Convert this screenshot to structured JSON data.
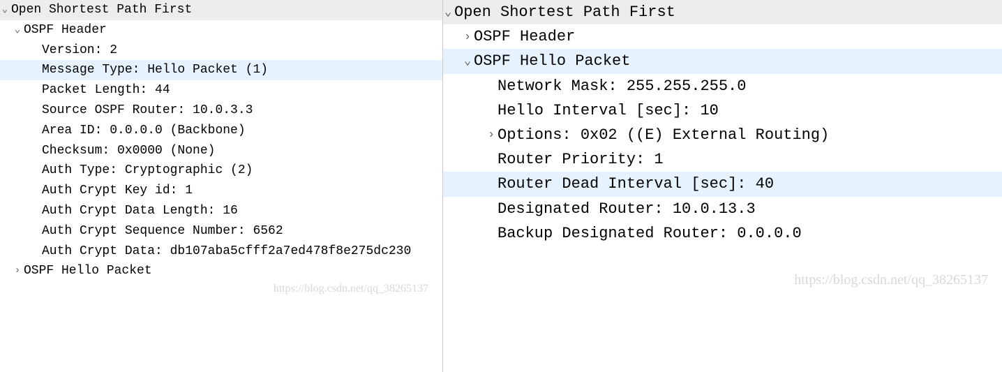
{
  "left": {
    "root": "Open Shortest Path First",
    "header_label": "OSPF Header",
    "fields": {
      "version": "Version: 2",
      "message_type": "Message Type: Hello Packet (1)",
      "packet_length": "Packet Length: 44",
      "source_router": "Source OSPF Router: 10.0.3.3",
      "area_id": "Area ID: 0.0.0.0 (Backbone)",
      "checksum": "Checksum: 0x0000 (None)",
      "auth_type": "Auth Type: Cryptographic (2)",
      "auth_key_id": "Auth Crypt Key id: 1",
      "auth_data_length": "Auth Crypt Data Length: 16",
      "auth_seq": "Auth Crypt Sequence Number: 6562",
      "auth_data": "Auth Crypt Data: db107aba5cfff2a7ed478f8e275dc230"
    },
    "hello_label": "OSPF Hello Packet",
    "watermark": "https://blog.csdn.net/qq_38265137"
  },
  "right": {
    "root": "Open Shortest Path First",
    "header_label": "OSPF Header",
    "hello_label": "OSPF Hello Packet",
    "fields": {
      "netmask": "Network Mask: 255.255.255.0",
      "hello_interval": "Hello Interval [sec]: 10",
      "options": "Options: 0x02 ((E) External Routing)",
      "router_priority": "Router Priority: 1",
      "dead_interval": "Router Dead Interval [sec]: 40",
      "dr": "Designated Router: 10.0.13.3",
      "bdr": "Backup Designated Router: 0.0.0.0"
    },
    "watermark": "https://blog.csdn.net/qq_38265137"
  },
  "glyphs": {
    "expanded": "⌄",
    "collapsed": "›"
  }
}
